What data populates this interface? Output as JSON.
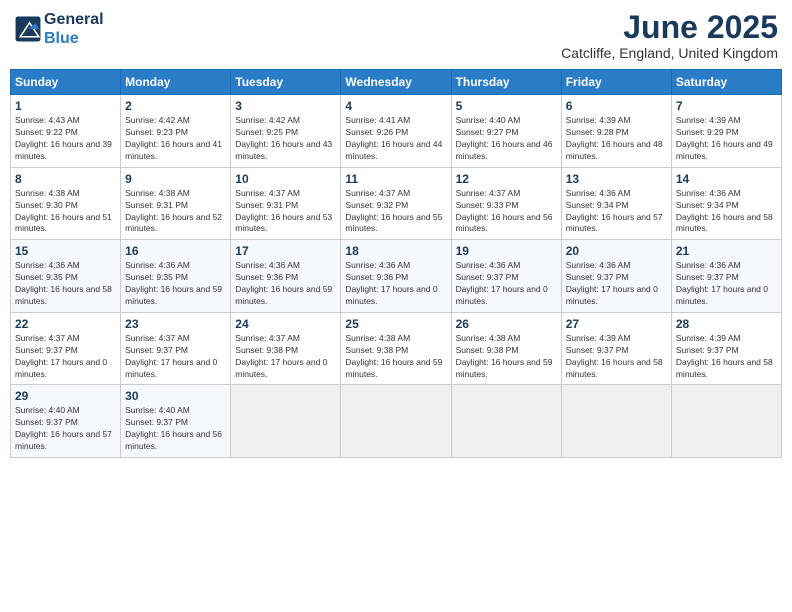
{
  "logo": {
    "line1": "General",
    "line2": "Blue"
  },
  "title": "June 2025",
  "location": "Catcliffe, England, United Kingdom",
  "headers": [
    "Sunday",
    "Monday",
    "Tuesday",
    "Wednesday",
    "Thursday",
    "Friday",
    "Saturday"
  ],
  "rows": [
    [
      null,
      null,
      null,
      null,
      null,
      null,
      null
    ]
  ],
  "days": {
    "row1": [
      {
        "num": "1",
        "sunrise": "Sunrise: 4:43 AM",
        "sunset": "Sunset: 9:22 PM",
        "daylight": "Daylight: 16 hours and 39 minutes."
      },
      {
        "num": "2",
        "sunrise": "Sunrise: 4:42 AM",
        "sunset": "Sunset: 9:23 PM",
        "daylight": "Daylight: 16 hours and 41 minutes."
      },
      {
        "num": "3",
        "sunrise": "Sunrise: 4:42 AM",
        "sunset": "Sunset: 9:25 PM",
        "daylight": "Daylight: 16 hours and 43 minutes."
      },
      {
        "num": "4",
        "sunrise": "Sunrise: 4:41 AM",
        "sunset": "Sunset: 9:26 PM",
        "daylight": "Daylight: 16 hours and 44 minutes."
      },
      {
        "num": "5",
        "sunrise": "Sunrise: 4:40 AM",
        "sunset": "Sunset: 9:27 PM",
        "daylight": "Daylight: 16 hours and 46 minutes."
      },
      {
        "num": "6",
        "sunrise": "Sunrise: 4:39 AM",
        "sunset": "Sunset: 9:28 PM",
        "daylight": "Daylight: 16 hours and 48 minutes."
      },
      {
        "num": "7",
        "sunrise": "Sunrise: 4:39 AM",
        "sunset": "Sunset: 9:29 PM",
        "daylight": "Daylight: 16 hours and 49 minutes."
      }
    ],
    "row2": [
      {
        "num": "8",
        "sunrise": "Sunrise: 4:38 AM",
        "sunset": "Sunset: 9:30 PM",
        "daylight": "Daylight: 16 hours and 51 minutes."
      },
      {
        "num": "9",
        "sunrise": "Sunrise: 4:38 AM",
        "sunset": "Sunset: 9:31 PM",
        "daylight": "Daylight: 16 hours and 52 minutes."
      },
      {
        "num": "10",
        "sunrise": "Sunrise: 4:37 AM",
        "sunset": "Sunset: 9:31 PM",
        "daylight": "Daylight: 16 hours and 53 minutes."
      },
      {
        "num": "11",
        "sunrise": "Sunrise: 4:37 AM",
        "sunset": "Sunset: 9:32 PM",
        "daylight": "Daylight: 16 hours and 55 minutes."
      },
      {
        "num": "12",
        "sunrise": "Sunrise: 4:37 AM",
        "sunset": "Sunset: 9:33 PM",
        "daylight": "Daylight: 16 hours and 56 minutes."
      },
      {
        "num": "13",
        "sunrise": "Sunrise: 4:36 AM",
        "sunset": "Sunset: 9:34 PM",
        "daylight": "Daylight: 16 hours and 57 minutes."
      },
      {
        "num": "14",
        "sunrise": "Sunrise: 4:36 AM",
        "sunset": "Sunset: 9:34 PM",
        "daylight": "Daylight: 16 hours and 58 minutes."
      }
    ],
    "row3": [
      {
        "num": "15",
        "sunrise": "Sunrise: 4:36 AM",
        "sunset": "Sunset: 9:35 PM",
        "daylight": "Daylight: 16 hours and 58 minutes."
      },
      {
        "num": "16",
        "sunrise": "Sunrise: 4:36 AM",
        "sunset": "Sunset: 9:35 PM",
        "daylight": "Daylight: 16 hours and 59 minutes."
      },
      {
        "num": "17",
        "sunrise": "Sunrise: 4:36 AM",
        "sunset": "Sunset: 9:36 PM",
        "daylight": "Daylight: 16 hours and 59 minutes."
      },
      {
        "num": "18",
        "sunrise": "Sunrise: 4:36 AM",
        "sunset": "Sunset: 9:36 PM",
        "daylight": "Daylight: 17 hours and 0 minutes."
      },
      {
        "num": "19",
        "sunrise": "Sunrise: 4:36 AM",
        "sunset": "Sunset: 9:37 PM",
        "daylight": "Daylight: 17 hours and 0 minutes."
      },
      {
        "num": "20",
        "sunrise": "Sunrise: 4:36 AM",
        "sunset": "Sunset: 9:37 PM",
        "daylight": "Daylight: 17 hours and 0 minutes."
      },
      {
        "num": "21",
        "sunrise": "Sunrise: 4:36 AM",
        "sunset": "Sunset: 9:37 PM",
        "daylight": "Daylight: 17 hours and 0 minutes."
      }
    ],
    "row4": [
      {
        "num": "22",
        "sunrise": "Sunrise: 4:37 AM",
        "sunset": "Sunset: 9:37 PM",
        "daylight": "Daylight: 17 hours and 0 minutes."
      },
      {
        "num": "23",
        "sunrise": "Sunrise: 4:37 AM",
        "sunset": "Sunset: 9:37 PM",
        "daylight": "Daylight: 17 hours and 0 minutes."
      },
      {
        "num": "24",
        "sunrise": "Sunrise: 4:37 AM",
        "sunset": "Sunset: 9:38 PM",
        "daylight": "Daylight: 17 hours and 0 minutes."
      },
      {
        "num": "25",
        "sunrise": "Sunrise: 4:38 AM",
        "sunset": "Sunset: 9:38 PM",
        "daylight": "Daylight: 16 hours and 59 minutes."
      },
      {
        "num": "26",
        "sunrise": "Sunrise: 4:38 AM",
        "sunset": "Sunset: 9:38 PM",
        "daylight": "Daylight: 16 hours and 59 minutes."
      },
      {
        "num": "27",
        "sunrise": "Sunrise: 4:39 AM",
        "sunset": "Sunset: 9:37 PM",
        "daylight": "Daylight: 16 hours and 58 minutes."
      },
      {
        "num": "28",
        "sunrise": "Sunrise: 4:39 AM",
        "sunset": "Sunset: 9:37 PM",
        "daylight": "Daylight: 16 hours and 58 minutes."
      }
    ],
    "row5": [
      {
        "num": "29",
        "sunrise": "Sunrise: 4:40 AM",
        "sunset": "Sunset: 9:37 PM",
        "daylight": "Daylight: 16 hours and 57 minutes."
      },
      {
        "num": "30",
        "sunrise": "Sunrise: 4:40 AM",
        "sunset": "Sunset: 9:37 PM",
        "daylight": "Daylight: 16 hours and 56 minutes."
      },
      null,
      null,
      null,
      null,
      null
    ]
  }
}
